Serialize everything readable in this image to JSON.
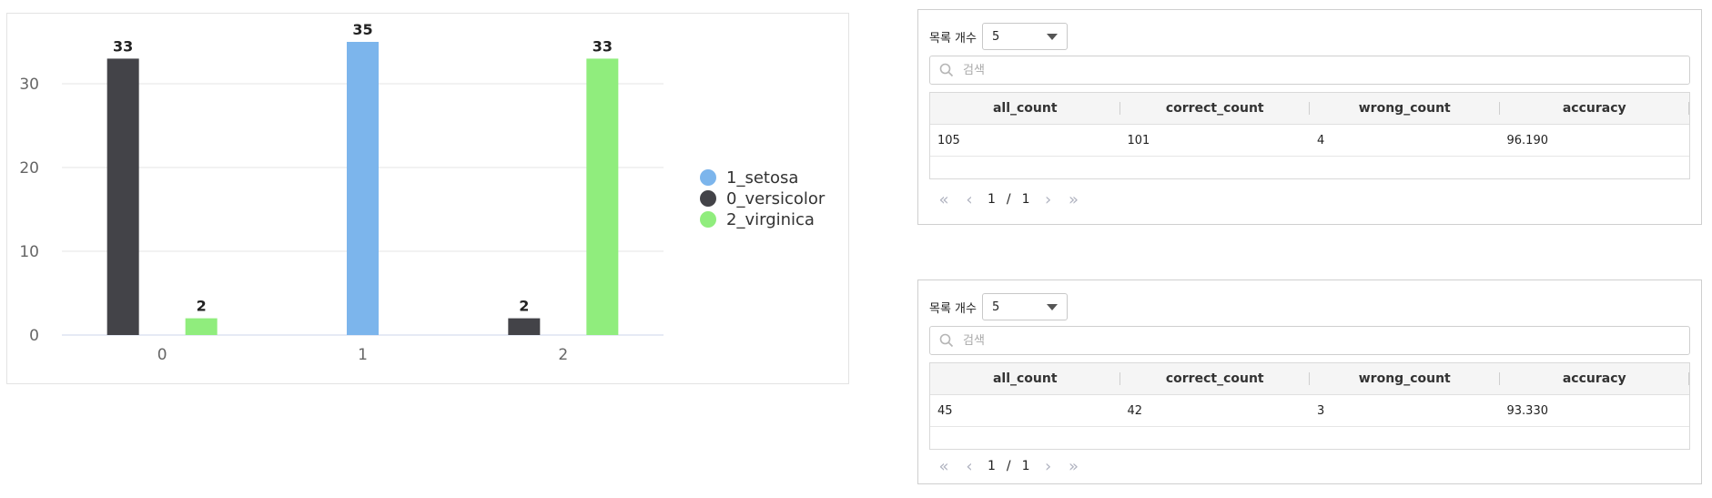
{
  "chart_data": {
    "type": "bar",
    "categories": [
      "0",
      "1",
      "2"
    ],
    "series": [
      {
        "name": "1_setosa",
        "color": "#7cb5ec",
        "values": [
          0,
          35,
          0
        ]
      },
      {
        "name": "0_versicolor",
        "color": "#434348",
        "values": [
          33,
          0,
          2
        ]
      },
      {
        "name": "2_virginica",
        "color": "#90ed7d",
        "values": [
          2,
          0,
          33
        ]
      }
    ],
    "y_ticks": [
      "0",
      "10",
      "20",
      "30"
    ],
    "ylim": [
      0,
      35
    ],
    "grid": true,
    "legend_position": "right"
  },
  "tables": [
    {
      "page_size_label": "목록 개수",
      "page_size_value": "5",
      "search_placeholder": "검색",
      "columns": [
        "all_count",
        "correct_count",
        "wrong_count",
        "accuracy"
      ],
      "row": [
        "105",
        "101",
        "4",
        "96.190"
      ],
      "pager": {
        "current": "1",
        "separator": "/",
        "total": "1"
      }
    },
    {
      "page_size_label": "목록 개수",
      "page_size_value": "5",
      "search_placeholder": "검색",
      "columns": [
        "all_count",
        "correct_count",
        "wrong_count",
        "accuracy"
      ],
      "row": [
        "45",
        "42",
        "3",
        "93.330"
      ],
      "pager": {
        "current": "1",
        "separator": "/",
        "total": "1"
      }
    }
  ]
}
